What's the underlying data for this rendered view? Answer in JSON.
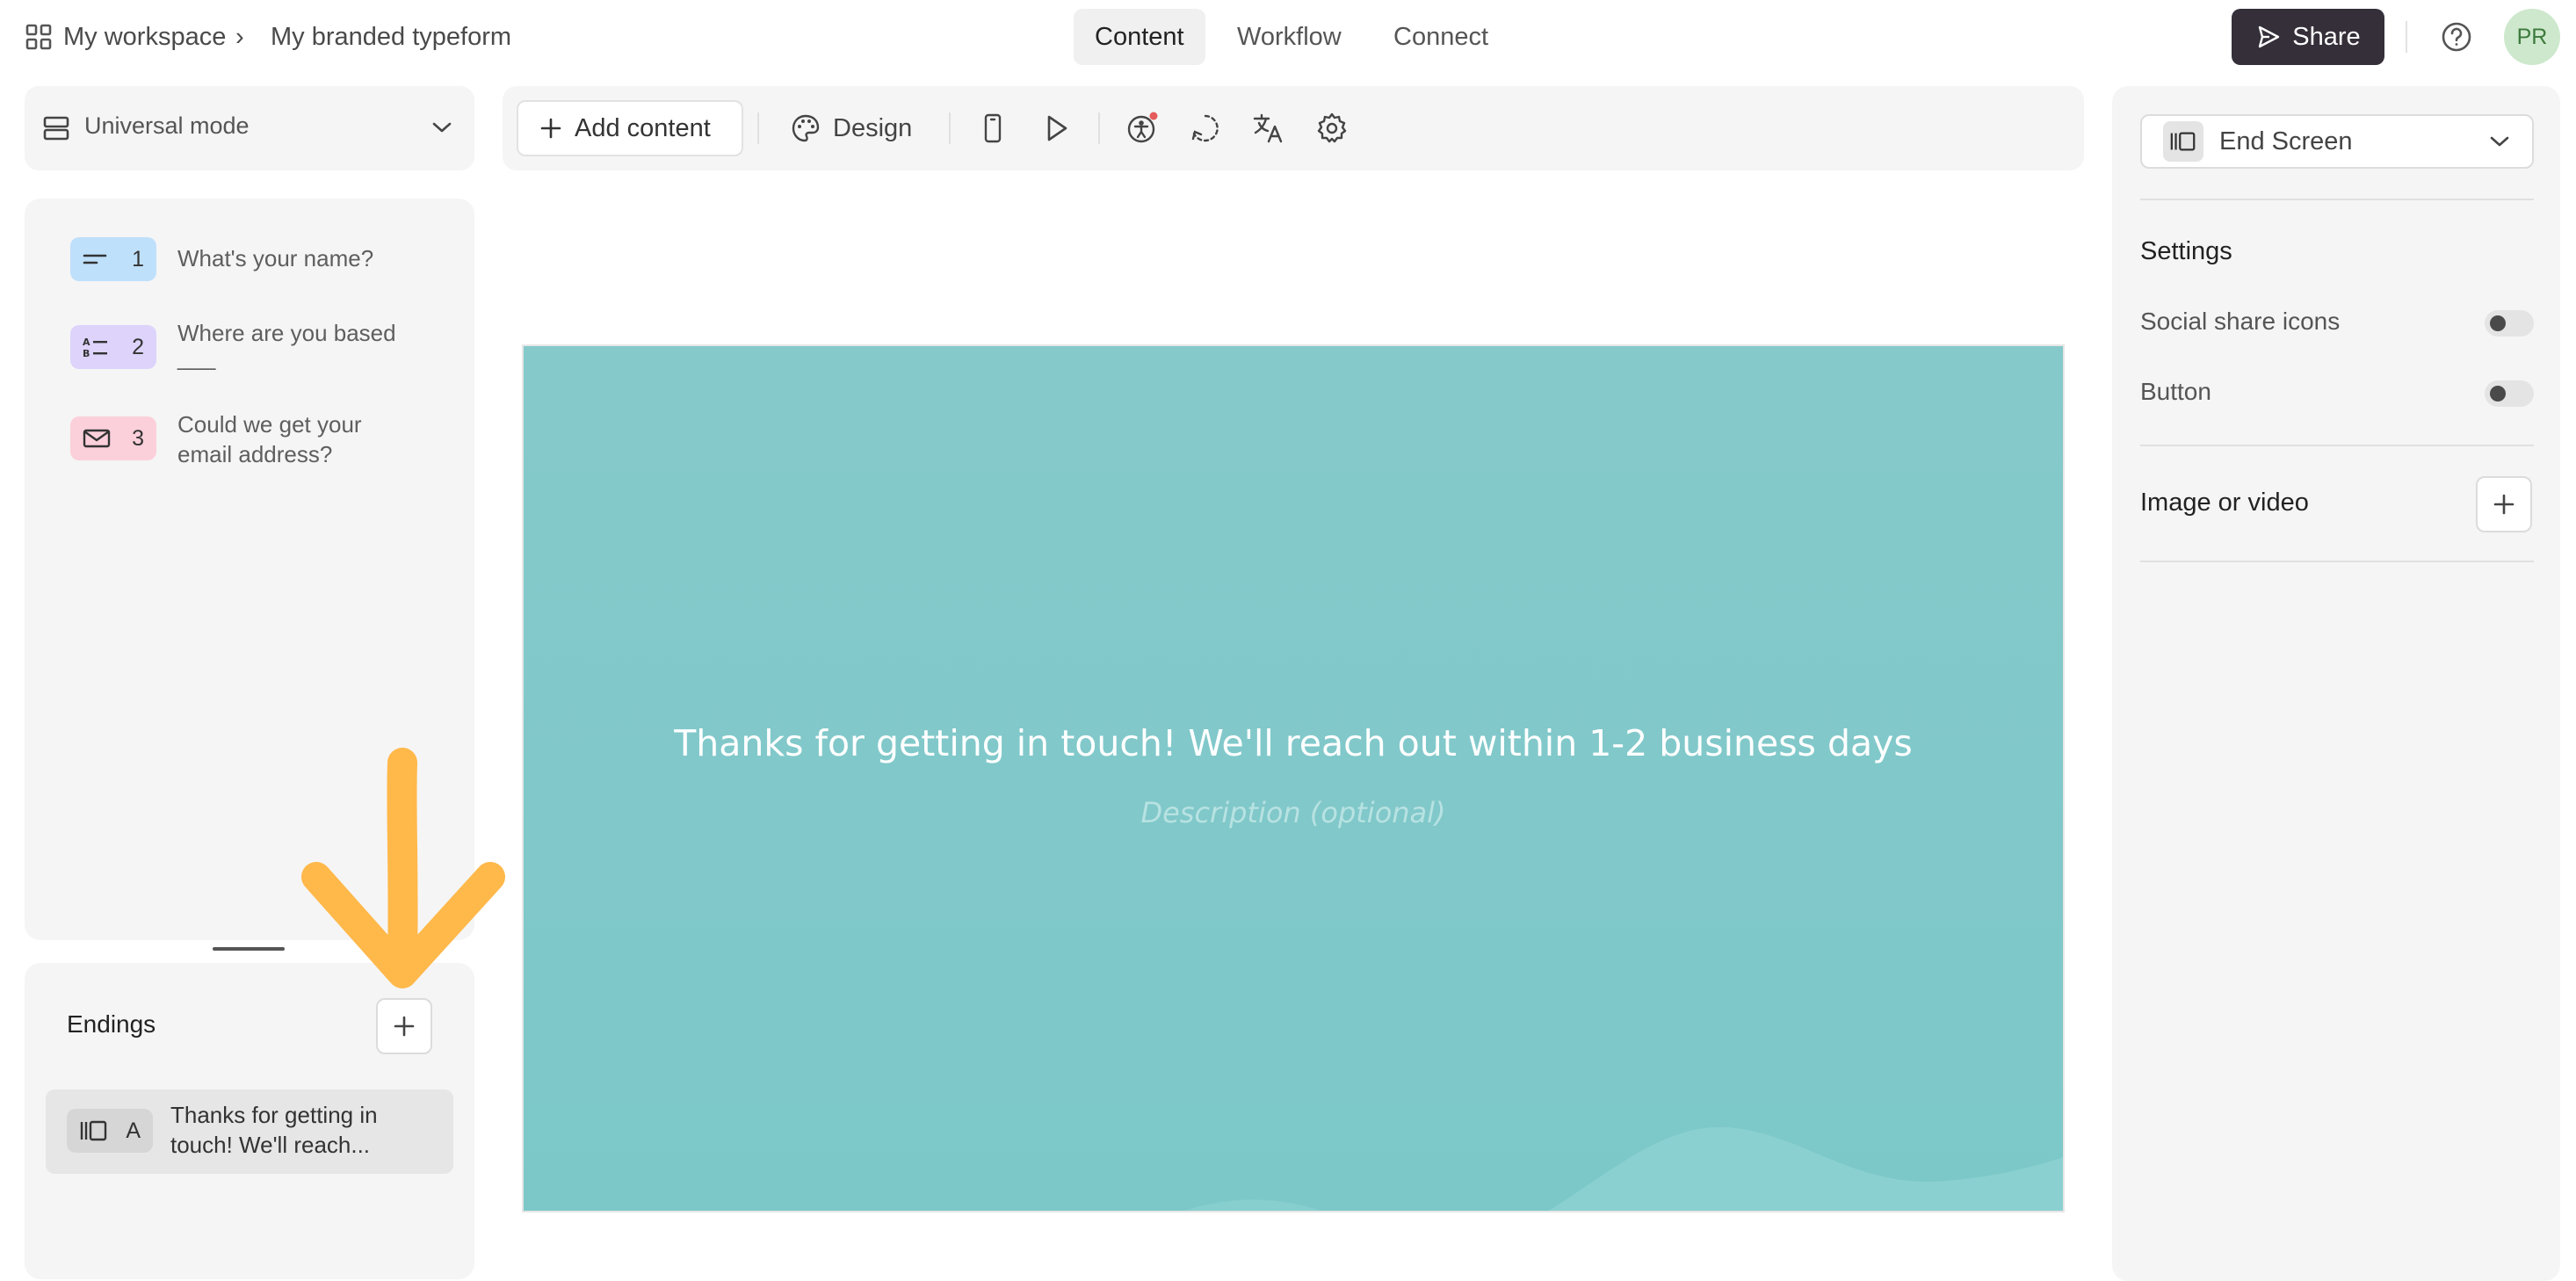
{
  "header": {
    "workspace": "My workspace",
    "breadcrumb_sep": "›",
    "form_name": "My branded typeform",
    "tabs": [
      {
        "label": "Content",
        "active": true
      },
      {
        "label": "Workflow",
        "active": false
      },
      {
        "label": "Connect",
        "active": false
      }
    ],
    "share_label": "Share",
    "avatar_initials": "PR"
  },
  "mode": {
    "label": "Universal mode"
  },
  "questions": [
    {
      "number": "1",
      "text_lines": [
        "What's your name?"
      ],
      "color": "#bfe0fb",
      "icon": "short-text-icon"
    },
    {
      "number": "2",
      "text_lines": [
        "Where are you based",
        "___"
      ],
      "color": "#ddd3fb",
      "icon": "multiple-choice-icon"
    },
    {
      "number": "3",
      "text_lines": [
        "Could we get your",
        "email address?"
      ],
      "color": "#fbd0da",
      "icon": "email-icon"
    }
  ],
  "endings": {
    "heading": "Endings",
    "items": [
      {
        "letter": "A",
        "text_lines": [
          "Thanks for getting in",
          "touch! We'll reach..."
        ],
        "icon": "end-screen-icon"
      }
    ]
  },
  "toolbar": {
    "add_content_label": "Add content",
    "design_label": "Design",
    "icons": [
      "mobile-preview-icon",
      "play-preview-icon",
      "accessibility-icon",
      "logic-icon",
      "translate-icon",
      "settings-icon"
    ]
  },
  "canvas": {
    "background": "#80c7c8",
    "title": "Thanks for getting in touch! We'll reach out within 1-2 business days",
    "description_placeholder": "Description (optional)"
  },
  "right_panel": {
    "screen_type": "End Screen",
    "settings_heading": "Settings",
    "toggles": [
      {
        "label": "Social share icons",
        "on": false
      },
      {
        "label": "Button",
        "on": false
      }
    ],
    "media_label": "Image or video"
  },
  "colors": {
    "accent_arrow": "#ffb84a",
    "share_button": "#352f3a",
    "avatar_bg": "#cde8cc"
  }
}
